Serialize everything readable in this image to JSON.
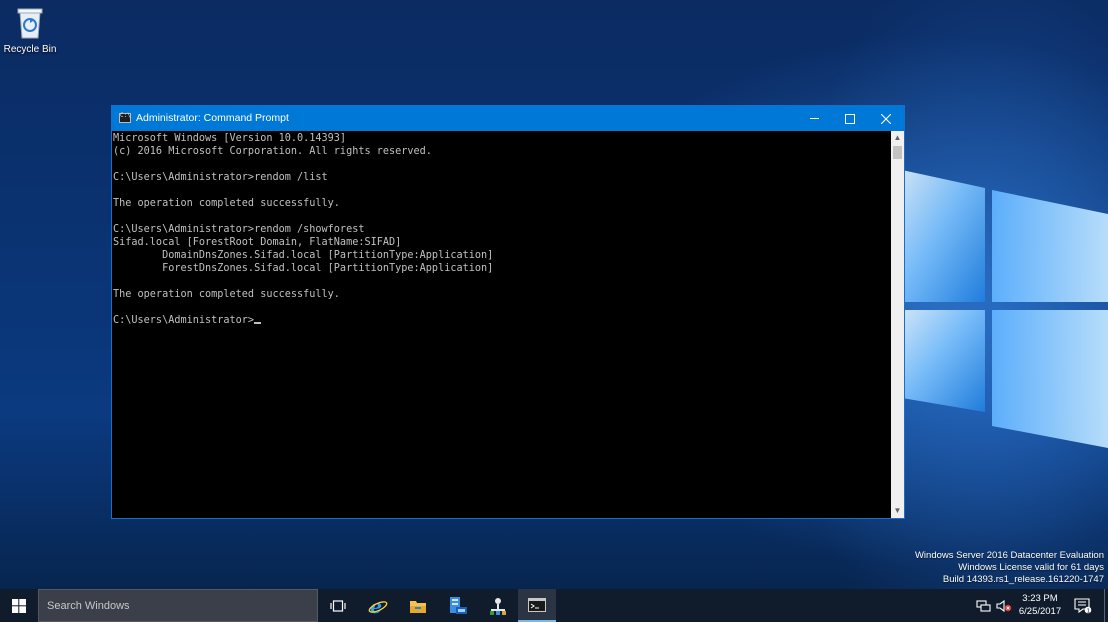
{
  "desktop": {
    "icons": [
      {
        "label": "Recycle Bin",
        "icon": "recycle-bin-icon"
      }
    ],
    "watermark": {
      "line1": "Windows Server 2016 Datacenter Evaluation",
      "line2": "Windows License valid for 61 days",
      "line3": "Build 14393.rs1_release.161220-1747"
    }
  },
  "window": {
    "title": "Administrator: Command Prompt",
    "accent_color": "#0078d7",
    "console_text_color": "#c0c0c0",
    "console_background": "#000000",
    "lines": [
      "Microsoft Windows [Version 10.0.14393]",
      "(c) 2016 Microsoft Corporation. All rights reserved.",
      "",
      "C:\\Users\\Administrator>rendom /list",
      "",
      "The operation completed successfully.",
      "",
      "C:\\Users\\Administrator>rendom /showforest",
      "Sifad.local [ForestRoot Domain, FlatName:SIFAD]",
      "        DomainDnsZones.Sifad.local [PartitionType:Application]",
      "        ForestDnsZones.Sifad.local [PartitionType:Application]",
      "",
      "The operation completed successfully.",
      ""
    ],
    "prompt": "C:\\Users\\Administrator>"
  },
  "taskbar": {
    "search_placeholder": "Search Windows",
    "pinned": [
      {
        "name": "task-view-icon"
      },
      {
        "name": "internet-explorer-icon"
      },
      {
        "name": "file-explorer-icon"
      },
      {
        "name": "server-manager-icon"
      },
      {
        "name": "network-admin-icon"
      },
      {
        "name": "command-prompt-icon",
        "active": true
      }
    ],
    "time": "3:23 PM",
    "date": "6/25/2017"
  }
}
